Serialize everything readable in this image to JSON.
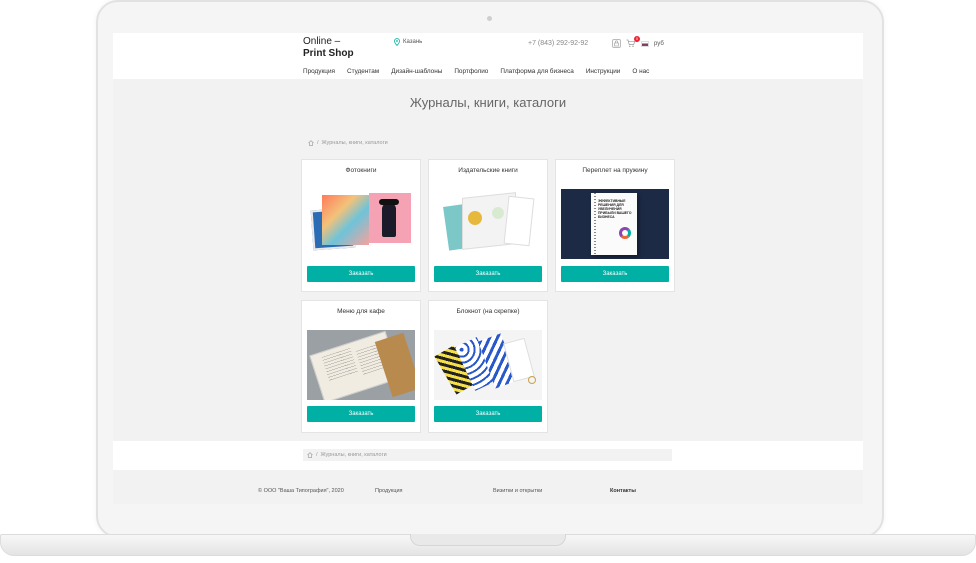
{
  "header": {
    "logo_line1": "Online –",
    "logo_line2": "Print Shop",
    "city": "Казань",
    "phone": "+7 (843) 292-92-92",
    "cart_count": "0",
    "currency": "руб"
  },
  "nav": {
    "items": [
      "Продукция",
      "Студентам",
      "Дизайн-шаблоны",
      "Портфолио",
      "Платформа для бизнеса",
      "Инструкции",
      "О нас"
    ]
  },
  "page": {
    "title": "Журналы, книги, каталоги",
    "breadcrumb": "Журналы, книги, каталоги"
  },
  "cards": [
    {
      "title": "Фотокниги",
      "button": "Заказать"
    },
    {
      "title": "Издательские книги",
      "button": "Заказать"
    },
    {
      "title": "Переплет на пружину",
      "button": "Заказать",
      "cover_text": "ЭФФЕКТИВНЫЕ РЕШЕНИЯ ДЛЯ УВЕЛИЧЕНИЯ ПРИБЫЛИ ВАШЕГО БИЗНЕСА"
    },
    {
      "title": "Меню для кафе",
      "button": "Заказать"
    },
    {
      "title": "Блокнот (на скрепке)",
      "button": "Заказать"
    }
  ],
  "footer": {
    "copyright": "© ООО \"Ваша Типография\", 2020",
    "col2": "Продукция",
    "col3": "Визитки и открытки",
    "col4": "Контакты"
  },
  "colors": {
    "accent": "#00b0a5",
    "background": "#f2f2f2"
  }
}
